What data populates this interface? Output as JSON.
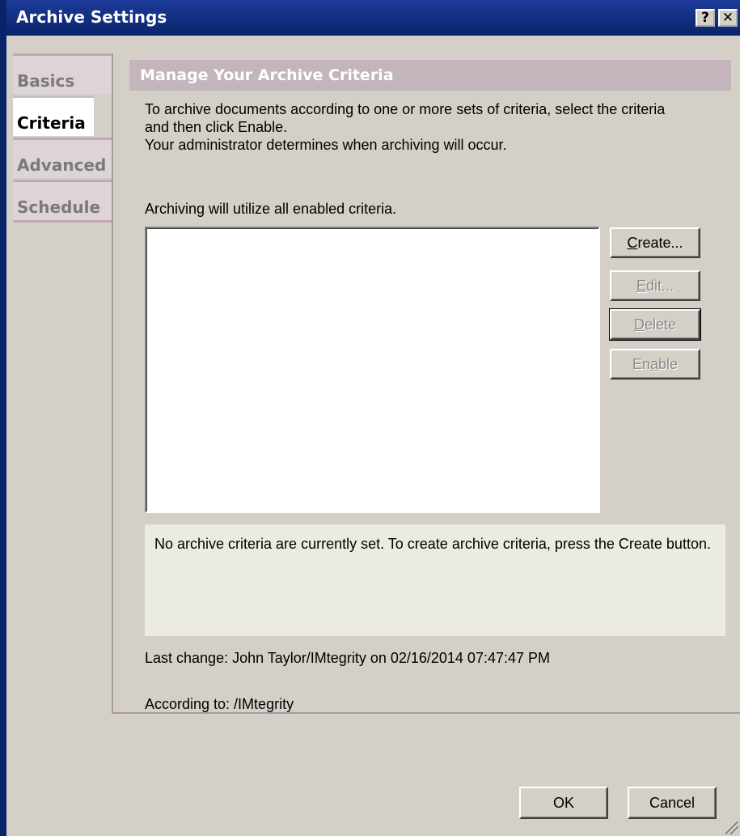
{
  "window": {
    "title": "Archive Settings",
    "help_button": "?",
    "close_button": "✕"
  },
  "tabs": [
    {
      "label": "Basics",
      "active": false
    },
    {
      "label": "Criteria",
      "active": true
    },
    {
      "label": "Advanced",
      "active": false
    },
    {
      "label": "Schedule",
      "active": false
    }
  ],
  "criteria": {
    "header": "Manage Your Archive Criteria",
    "description_line1": "To archive documents according to one or more sets of criteria, select the criteria",
    "description_line2": "and then click Enable.",
    "description_line3": "Your administrator determines when archiving will occur.",
    "utilize_text": "Archiving will utilize all enabled criteria.",
    "items": [],
    "buttons": {
      "create": {
        "pre": "",
        "key": "C",
        "post": "reate...",
        "enabled": true
      },
      "edit": {
        "pre": "",
        "key": "E",
        "post": "dit...",
        "enabled": false
      },
      "delete": {
        "pre": "",
        "key": "D",
        "post": "elete",
        "enabled": false
      },
      "enable": {
        "pre": "En",
        "key": "a",
        "post": "ble",
        "enabled": false
      }
    },
    "info_text": "No archive criteria are currently set. To create archive criteria, press the Create button.",
    "last_change": "Last change: John Taylor/IMtegrity on 02/16/2014 07:47:47 PM",
    "according_to": "According to: /IMtegrity"
  },
  "footer": {
    "ok_label": "OK",
    "cancel_label": "Cancel"
  }
}
